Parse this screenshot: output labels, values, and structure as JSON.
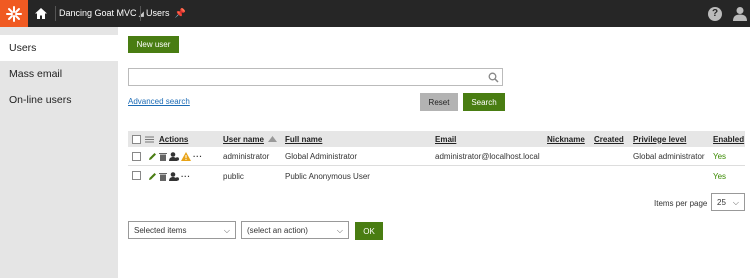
{
  "header": {
    "site_name": "Dancing Goat MVC",
    "app_name": "Users",
    "help_label": "?"
  },
  "sidebar": {
    "items": [
      {
        "label": "Users"
      },
      {
        "label": "Mass email"
      },
      {
        "label": "On-line users"
      }
    ]
  },
  "toolbar": {
    "new_user_label": "New user"
  },
  "search": {
    "value": "",
    "placeholder": "",
    "advanced_label": "Advanced search",
    "reset_label": "Reset",
    "search_label": "Search"
  },
  "table": {
    "columns": {
      "actions": "Actions",
      "username": "User name",
      "fullname": "Full name",
      "email": "Email",
      "nickname": "Nickname",
      "created": "Created",
      "privilege": "Privilege level",
      "enabled": "Enabled"
    },
    "rows": [
      {
        "username": "administrator",
        "fullname": "Global Administrator",
        "email": "administrator@localhost.local",
        "nickname": "",
        "created": "",
        "privilege": "Global administrator",
        "enabled": "Yes",
        "warning": true
      },
      {
        "username": "public",
        "fullname": "Public Anonymous User",
        "email": "",
        "nickname": "",
        "created": "",
        "privilege": "",
        "enabled": "Yes",
        "warning": false
      }
    ]
  },
  "pagination": {
    "items_per_page_label": "Items per page",
    "items_per_page_value": "25"
  },
  "mass_action": {
    "scope_value": "Selected items",
    "action_value": "(select an action)",
    "ok_label": "OK"
  },
  "colors": {
    "accent_green": "#497d12",
    "logo_orange": "#f05a22",
    "topbar": "#262626",
    "enabled_green": "#3a8a00",
    "warning_orange": "#e8a317"
  }
}
